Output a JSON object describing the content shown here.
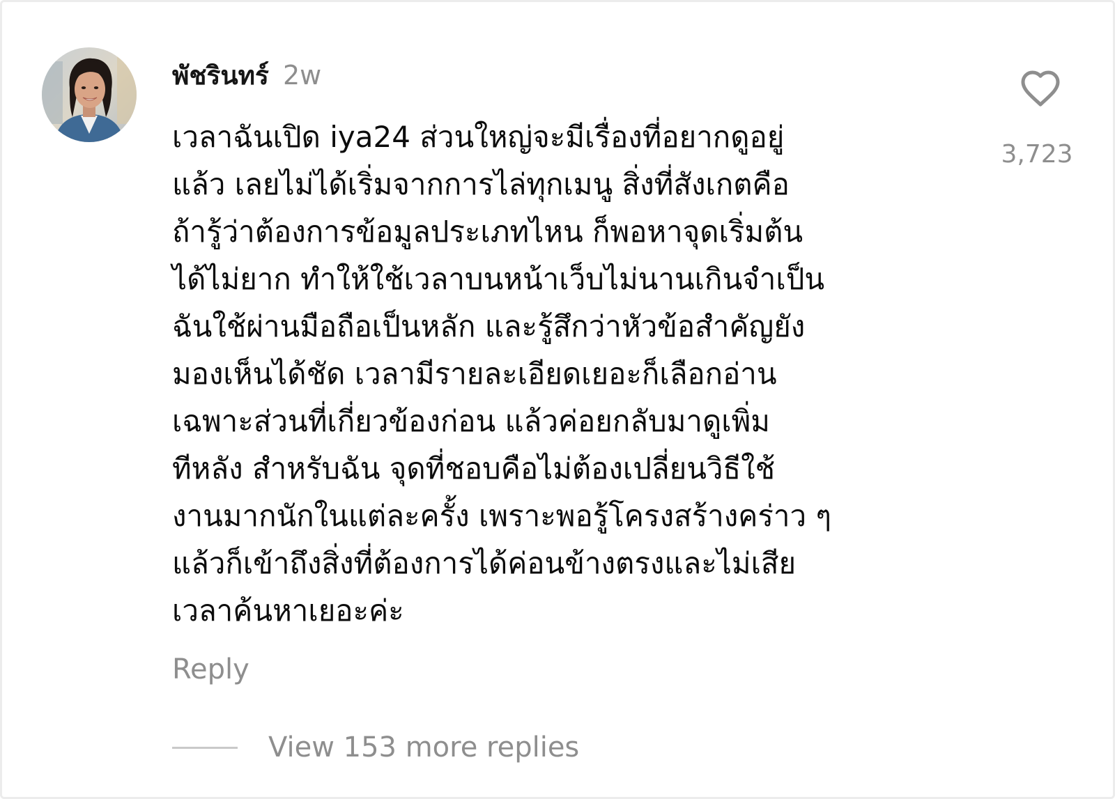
{
  "comment": {
    "username": "พัชรินทร์",
    "timestamp": "2w",
    "avatar_icon": "user-avatar-photo",
    "lines": [
      "เวลาฉันเปิด iya24 ส่วนใหญ่จะมีเรื่องที่อยากดูอยู่",
      "แล้ว เลยไม่ได้เริ่มจากการไล่ทุกเมนู สิ่งที่สังเกตคือ",
      "ถ้ารู้ว่าต้องการข้อมูลประเภทไหน ก็พอหาจุดเริ่มต้น",
      "ได้ไม่ยาก ทำให้ใช้เวลาบนหน้าเว็บไม่นานเกินจำเป็น",
      "ฉันใช้ผ่านมือถือเป็นหลัก และรู้สึกว่าหัวข้อสำคัญยัง",
      "มองเห็นได้ชัด เวลามีรายละเอียดเยอะก็เลือกอ่าน",
      "เฉพาะส่วนที่เกี่ยวข้องก่อน แล้วค่อยกลับมาดูเพิ่ม",
      "ทีหลัง สำหรับฉัน จุดที่ชอบคือไม่ต้องเปลี่ยนวิธีใช้",
      "งานมากนักในแต่ละครั้ง เพราะพอรู้โครงสร้างคร่าว ๆ",
      "แล้วก็เข้าถึงสิ่งที่ต้องการได้ค่อนข้างตรงและไม่เสีย",
      "เวลาค้นหาเยอะค่ะ"
    ],
    "like_icon": "heart-outline-icon",
    "like_count": "3,723",
    "reply_label": "Reply",
    "view_replies_label": "View 153 more replies"
  },
  "colors": {
    "primary_text": "#0c0c0c",
    "secondary_text": "#8e8e8e",
    "divider": "#c9c9c9"
  }
}
